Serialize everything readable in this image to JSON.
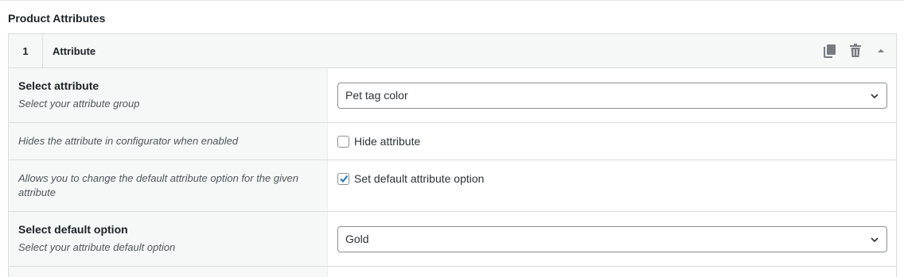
{
  "section": {
    "title": "Product Attributes"
  },
  "panel": {
    "number": "1",
    "label": "Attribute",
    "icons": [
      "copy-icon",
      "trash-icon",
      "collapse-up-icon"
    ]
  },
  "rows": {
    "select_attribute": {
      "label": "Select attribute",
      "description": "Select your attribute group",
      "value": "Pet tag color"
    },
    "hide_attribute": {
      "description": "Hides the attribute in configurator when enabled",
      "checkbox_label": "Hide attribute",
      "checked": false
    },
    "default_option_toggle": {
      "description": "Allows you to change the default attribute option for the given attribute",
      "checkbox_label": "Set default attribute option",
      "checked": true
    },
    "select_default": {
      "label": "Select default option",
      "description": "Select your attribute default option",
      "value": "Gold"
    }
  },
  "colors": {
    "accent": "#2271b1",
    "panel_bg": "#f6f7f7",
    "border": "#dcdcde"
  }
}
